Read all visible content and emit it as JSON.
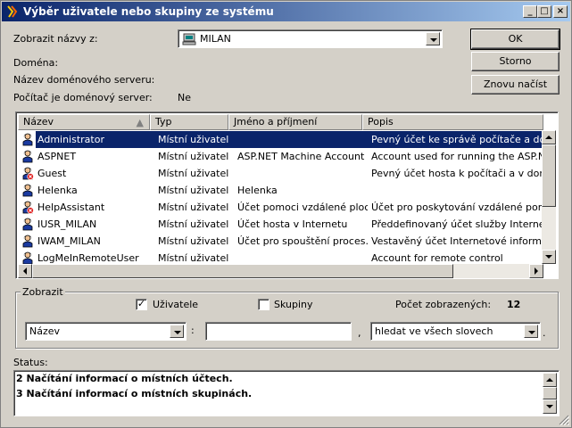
{
  "window": {
    "title": "Výběr uživatele nebo skupiny ze systému"
  },
  "titlebar": {
    "minimize": "_",
    "maximize": "□",
    "close": "×"
  },
  "form": {
    "names_from_label": "Zobrazit názvy z:",
    "names_from_value": "MILAN",
    "domain_label": "Doména:",
    "domain_server_label": "Název doménového serveru:",
    "is_domain_server_label": "Počítač je doménový server:",
    "is_domain_server_value": "Ne"
  },
  "buttons": {
    "ok": "OK",
    "cancel": "Storno",
    "reload": "Znovu načíst"
  },
  "table": {
    "columns": [
      "Název",
      "Typ",
      "Jméno a příjmení",
      "Popis"
    ],
    "rows": [
      {
        "name": "Administrator",
        "type": "Místní uživatel",
        "fullname": "",
        "desc": "Pevný účet ke správě počítače a domény",
        "icon": "user-icon",
        "selected": true
      },
      {
        "name": "ASPNET",
        "type": "Místní uživatel",
        "fullname": "ASP.NET Machine Account",
        "desc": "Account used for running the ASP.NET w",
        "icon": "user-icon"
      },
      {
        "name": "Guest",
        "type": "Místní uživatel",
        "fullname": "",
        "desc": "Pevný účet hosta k počítači a v doméně",
        "icon": "disabled-user-icon"
      },
      {
        "name": "Helenka",
        "type": "Místní uživatel",
        "fullname": "Helenka",
        "desc": "",
        "icon": "user-icon"
      },
      {
        "name": "HelpAssistant",
        "type": "Místní uživatel",
        "fullname": "Účet pomoci vzdálené ploc...",
        "desc": "Účet pro poskytování vzdálené pomoci.",
        "icon": "disabled-user-icon"
      },
      {
        "name": "IUSR_MILAN",
        "type": "Místní uživatel",
        "fullname": "Účet hosta v Internetu",
        "desc": "Předdefinovaný účet služby Internet Infor",
        "icon": "user-icon"
      },
      {
        "name": "IWAM_MILAN",
        "type": "Místní uživatel",
        "fullname": "Účet pro spouštění proces...",
        "desc": "Vestavěný účet Internetové informační slu",
        "icon": "user-icon"
      },
      {
        "name": "LogMeInRemoteUser",
        "type": "Místní uživatel",
        "fullname": "",
        "desc": "Account for remote control",
        "icon": "user-icon"
      }
    ]
  },
  "filter": {
    "group_label": "Zobrazit",
    "users_label": "Uživatele",
    "users_checked": true,
    "groups_label": "Skupiny",
    "groups_checked": false,
    "count_label": "Počet zobrazených:",
    "count_value": "12",
    "field_value": "Název",
    "colon": ":",
    "comma": ",",
    "search_text": "",
    "mode_value": "hledat ve všech slovech",
    "period": "."
  },
  "status": {
    "label": "Status:",
    "lines": [
      "2 Načítání informací o místních účtech.",
      "3 Načítání informací o místních skupinách."
    ]
  },
  "colors": {
    "title_start": "#0a246a",
    "title_end": "#a6caf0",
    "selection": "#0a246a",
    "face": "#d4d0c8"
  }
}
